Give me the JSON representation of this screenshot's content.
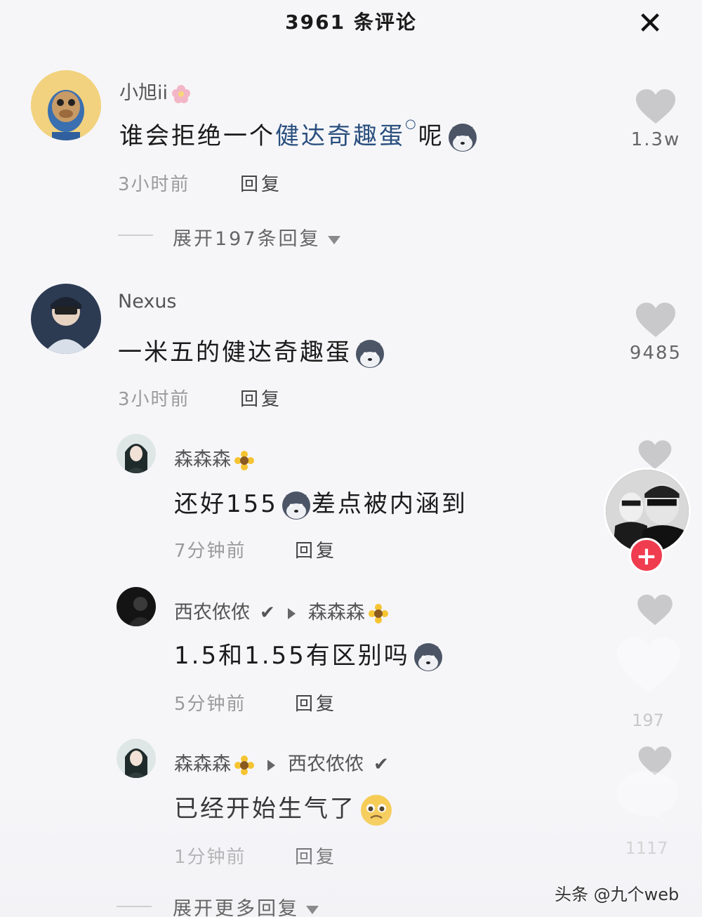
{
  "header": {
    "title": "3961 条评论",
    "close_label": "✕"
  },
  "comments": [
    {
      "username": "小旭ii",
      "text_prefix": "谁会拒绝一个",
      "link": "健达奇趣蛋",
      "text_suffix": "呢",
      "time": "3小时前",
      "reply": "回复",
      "likes": "1.3w",
      "expand": "展开197条回复"
    },
    {
      "username": "Nexus",
      "text": "一米五的健达奇趣蛋",
      "time": "3小时前",
      "reply": "回复",
      "likes": "9485"
    }
  ],
  "replies": [
    {
      "username": "森森森",
      "text_prefix": "还好155",
      "text_suffix": "差点被内涵到",
      "time": "7分钟前",
      "reply": "回复"
    },
    {
      "username": "西农侬侬",
      "verified": "✔",
      "reply_to": "森森森",
      "text": "1.5和1.55有区别吗",
      "time": "5分钟前",
      "reply": "回复"
    },
    {
      "username": "森森森",
      "reply_to": "西农侬侬",
      "reply_to_verified": "✔",
      "text": "已经开始生气了",
      "time": "1分钟前",
      "reply": "回复"
    }
  ],
  "expand_more": "展开更多回复",
  "side": {
    "follow": "+",
    "ghost_counts": [
      "197",
      "1117"
    ]
  },
  "watermark": "头条 @九个web",
  "colors": {
    "accent": "#f03c4f",
    "link": "#2a4f7e",
    "heart": "#c9c9cc"
  }
}
